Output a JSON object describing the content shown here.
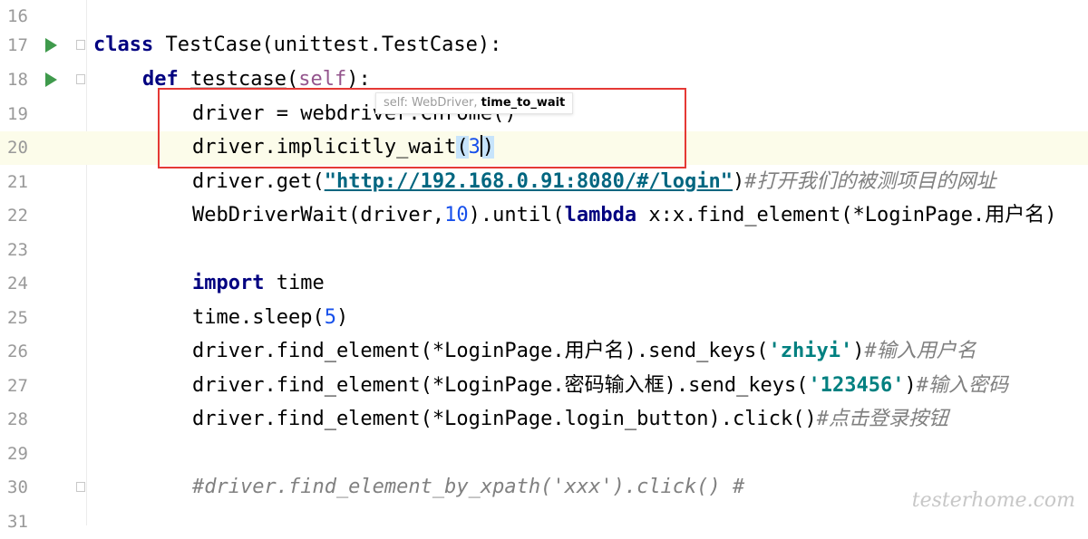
{
  "editor": {
    "line_numbers": [
      "16",
      "17",
      "18",
      "19",
      "20",
      "21",
      "22",
      "23",
      "24",
      "25",
      "26",
      "27",
      "28",
      "29",
      "30",
      "31"
    ],
    "tooltip": {
      "param_inactive": "self: WebDriver,",
      "param_active": "time_to_wait"
    },
    "lines": {
      "l17": {
        "kw": "class",
        "rest": " TestCase(unittest.TestCase):"
      },
      "l18": {
        "kw": "def",
        "fn": "testcase",
        "open": "(",
        "self": "self",
        "close": "):"
      },
      "l19": {
        "text": "driver = webdriver.Chrome()"
      },
      "l20": {
        "text": "driver.implicitly_wait",
        "open": "(",
        "num": "3",
        "close": ")"
      },
      "l21": {
        "pre": "driver.get(",
        "url": "\"http://192.168.0.91:8080/#/login\"",
        "post": ")",
        "comment": "#打开我们的被测项目的网址"
      },
      "l22": {
        "pre": "WebDriverWait(driver,",
        "num": "10",
        "mid": ").until(",
        "kw": "lambda",
        "post": " x:x.find_element(*LoginPage.用户名)"
      },
      "l24": {
        "kw": "import",
        "rest": " time"
      },
      "l25": {
        "pre": "time.sleep(",
        "num": "5",
        "post": ")"
      },
      "l26": {
        "pre": "driver.find_element(*LoginPage.用户名).send_keys(",
        "str": "'zhiyi'",
        "post": ")",
        "comment": "#输入用户名"
      },
      "l27": {
        "pre": "driver.find_element(*LoginPage.密码输入框).send_keys(",
        "str": "'123456'",
        "post": ")",
        "comment": "#输入密码"
      },
      "l28": {
        "pre": "driver.find_element(*LoginPage.login_button).click()",
        "comment": "#点击登录按钮"
      },
      "l30": {
        "comment": "#driver.find_element_by_xpath('xxx').click() #"
      }
    }
  },
  "watermark": "testerhome.com",
  "colors": {
    "keyword": "#000080",
    "number": "#1750eb",
    "string": "#008080",
    "comment": "#808080",
    "highlight_box": "#e53935",
    "run_icon": "#3f9a4c"
  }
}
